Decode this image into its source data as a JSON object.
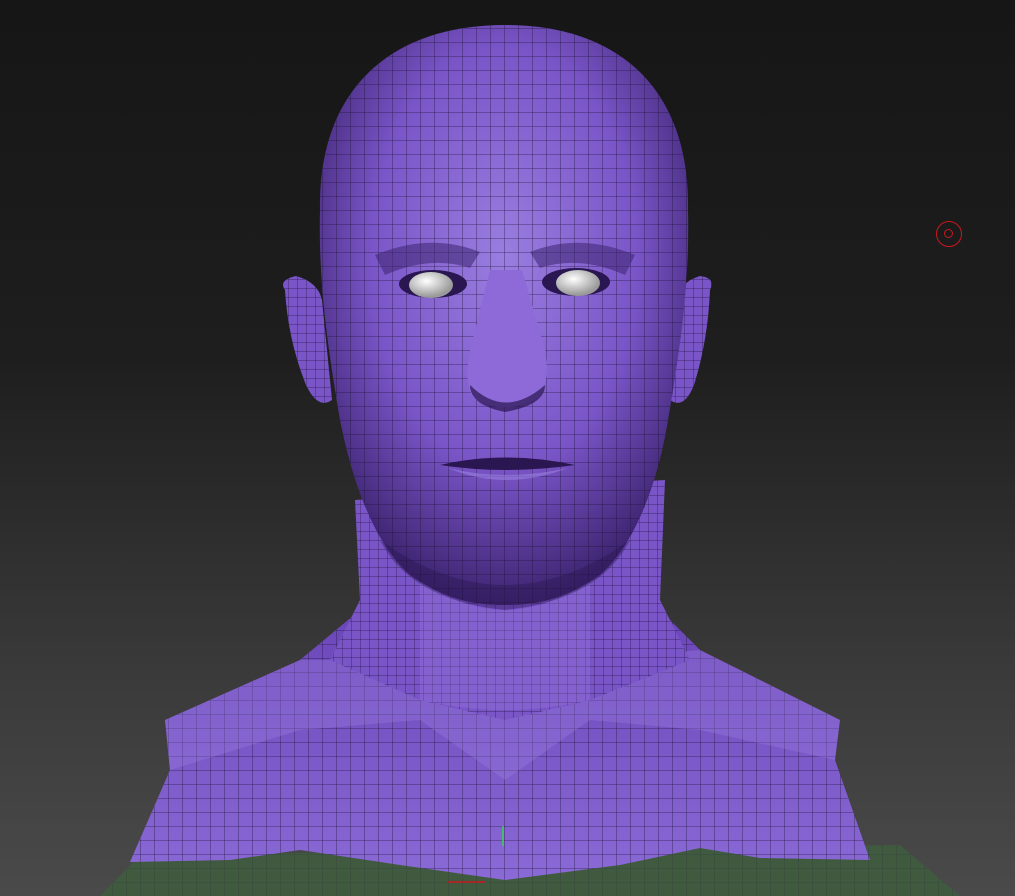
{
  "app": {
    "canvas_background": "#1e1e1e",
    "mesh_color": "#7a55c8",
    "mesh_shadow": "#3d2470",
    "mesh_highlight": "#9a7ee0",
    "wire_color": "#1b0f33",
    "floor_color": "#3f5a3f",
    "eye_color": "#d8d8d8",
    "gizmo_color": "#c8181e"
  },
  "viewport": {
    "model": "head-bust-mesh",
    "rotation_gizmo_icon": "rotate-gizmo-icon",
    "floor_grid": true
  }
}
